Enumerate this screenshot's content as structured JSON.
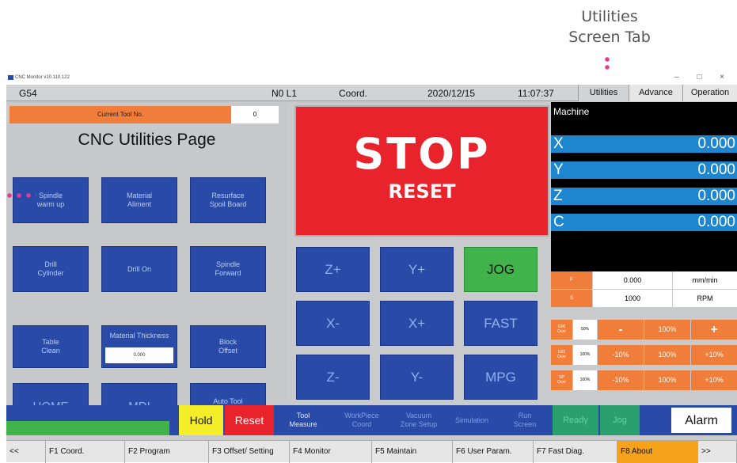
{
  "annotation": {
    "label": "Utilities\nScreen Tab"
  },
  "window": {
    "title": "CNC Monitor v10.110.122",
    "controls": "– □ ×"
  },
  "status": {
    "work_coord": "G54",
    "line": "N0 L1",
    "coord_label": "Coord.",
    "date": "2020/12/15",
    "time": "11:07:37",
    "tabs": [
      "Utilities",
      "Advance",
      "Operation"
    ]
  },
  "left": {
    "current_tool_label": "Current Tool No.",
    "current_tool_value": "0",
    "page_title": "CNC Utilities Page",
    "buttons": [
      {
        "label": "Spindle\nwarm up"
      },
      {
        "label": "Material\nAliment"
      },
      {
        "label": "Resurface\nSpoil Board"
      },
      {
        "label": "Drill\nCylinder"
      },
      {
        "label": "Drill On"
      },
      {
        "label": "Spindle\nForward"
      },
      {
        "label": "Table\nClean"
      },
      {
        "label": "Block\nOffset"
      },
      {
        "label": "HOME"
      },
      {
        "label": "MDI"
      },
      {
        "label": "Auto Tool\nMeasure"
      }
    ],
    "material_thickness_label": "Material Thickness",
    "material_thickness_value": "0.000"
  },
  "stop": {
    "title": "STOP",
    "subtitle": "RESET",
    "color": "#e8232b"
  },
  "jog": {
    "buttons": [
      "Z+",
      "Y+",
      "JOG",
      "X-",
      "X+",
      "FAST",
      "Z-",
      "Y-",
      "MPG"
    ]
  },
  "machine": {
    "header": "Machine",
    "axes": [
      {
        "name": "X",
        "value": "0.000"
      },
      {
        "name": "Y",
        "value": "0.000"
      },
      {
        "name": "Z",
        "value": "0.000"
      },
      {
        "name": "C",
        "value": "0.000"
      }
    ]
  },
  "feed": {
    "key": "F",
    "value": "0.000",
    "unit": "mm/min"
  },
  "spindle": {
    "key": "S",
    "value": "1000",
    "unit": "RPM"
  },
  "overrides": [
    {
      "key": "G00\nOver",
      "pct": "50%",
      "minus": "-",
      "mid": "100%",
      "plus": "+"
    },
    {
      "key": "G01\nOver",
      "pct": "100%",
      "minus": "-10%",
      "mid": "100%",
      "plus": "+10%"
    },
    {
      "key": "SP\nOver",
      "pct": "100%",
      "minus": "-10%",
      "mid": "100%",
      "plus": "+10%"
    }
  ],
  "actions": {
    "hold": "Hold",
    "reset": "Reset",
    "tool_measure": "Tool\nMeasure",
    "workpiece_coord": "WorkPiece\nCoord",
    "vacuum": "Vacuum\nZone Setup",
    "simulation": "Simulation",
    "run_screen": "Run\nScreen",
    "ready": "Ready",
    "jog": "Jog",
    "alarm": "Alarm"
  },
  "fkeys": [
    "<<",
    "F1 Coord.",
    "F2 Program",
    "F3 Offset/ Setting",
    "F4 Monitor",
    "F5 Maintain",
    "F6 User Param.",
    "F7 Fast Diag.",
    "F8 About",
    ">>"
  ]
}
